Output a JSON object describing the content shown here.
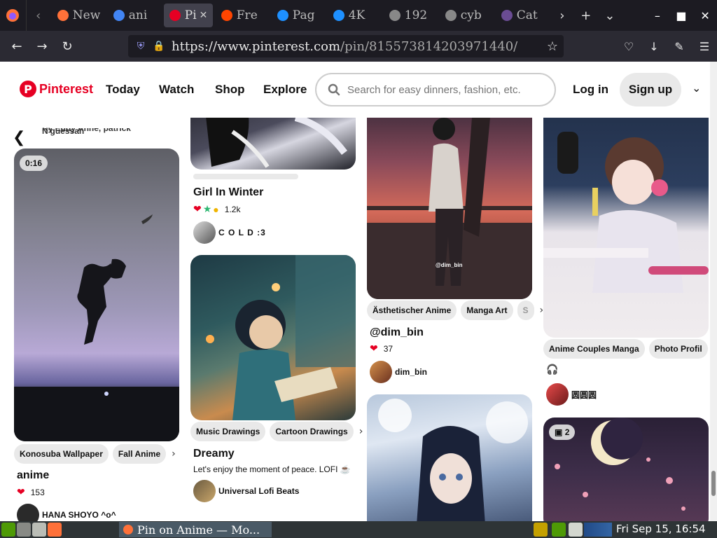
{
  "browser": {
    "tabs": [
      {
        "label": "New",
        "fav_color": "#ff7139"
      },
      {
        "label": "ani",
        "fav_color": "#4285f4"
      },
      {
        "label": "Pi",
        "fav_color": "#e60023",
        "active": true
      },
      {
        "label": "Fre",
        "fav_color": "#ff4500"
      },
      {
        "label": "Pag",
        "fav_color": "#1e90ff"
      },
      {
        "label": "4K",
        "fav_color": "#1e90ff"
      },
      {
        "label": "192",
        "fav_color": "#888888"
      },
      {
        "label": "cyb",
        "fav_color": "#888888"
      },
      {
        "label": "Cat",
        "fav_color": "#6a4c93"
      }
    ],
    "url_host": "https://www.pinterest.com",
    "url_path": "/pin/815573814203971440/"
  },
  "pinterest": {
    "logo_letter": "P",
    "logo_text": "Pinterest",
    "nav": [
      "Today",
      "Watch",
      "Shop",
      "Explore"
    ],
    "search_placeholder": "Search for easy dinners, fashion, etc.",
    "login": "Log in",
    "signup": "Sign up"
  },
  "pins": {
    "col1": {
      "top_text": "Ky Eddy Anne, patrick",
      "top_text2": "N'guessan",
      "duration": "0:16",
      "tags": [
        "Konosuba Wallpaper",
        "Fall Anime"
      ],
      "title": "anime",
      "reactions": "153",
      "author": "HANA SHOYO ^o^"
    },
    "col2": {
      "title1": "Girl In Winter",
      "reactions1": "1.2k",
      "author1": "C O L D :3",
      "tags": [
        "Music Drawings",
        "Cartoon Drawings"
      ],
      "title2": "Dreamy",
      "desc2": "Let's enjoy the moment of peace. LOFI ☕",
      "author2": "Universal Lofi Beats"
    },
    "col3": {
      "watermark": "@dim_bin",
      "tags": [
        "Ästhetischer Anime",
        "Manga Art",
        "S"
      ],
      "title": "@dim_bin",
      "reactions": "37",
      "author": "dim_bin"
    },
    "col4": {
      "tags": [
        "Anime Couples Manga",
        "Photo Profil"
      ],
      "headphone_icon": "🎧",
      "author": "圆圆圆",
      "badge_count": "2"
    }
  },
  "taskbar": {
    "task_label": "Pin on Anime — Mo...",
    "clock": "Fri Sep 15, 16:54"
  }
}
